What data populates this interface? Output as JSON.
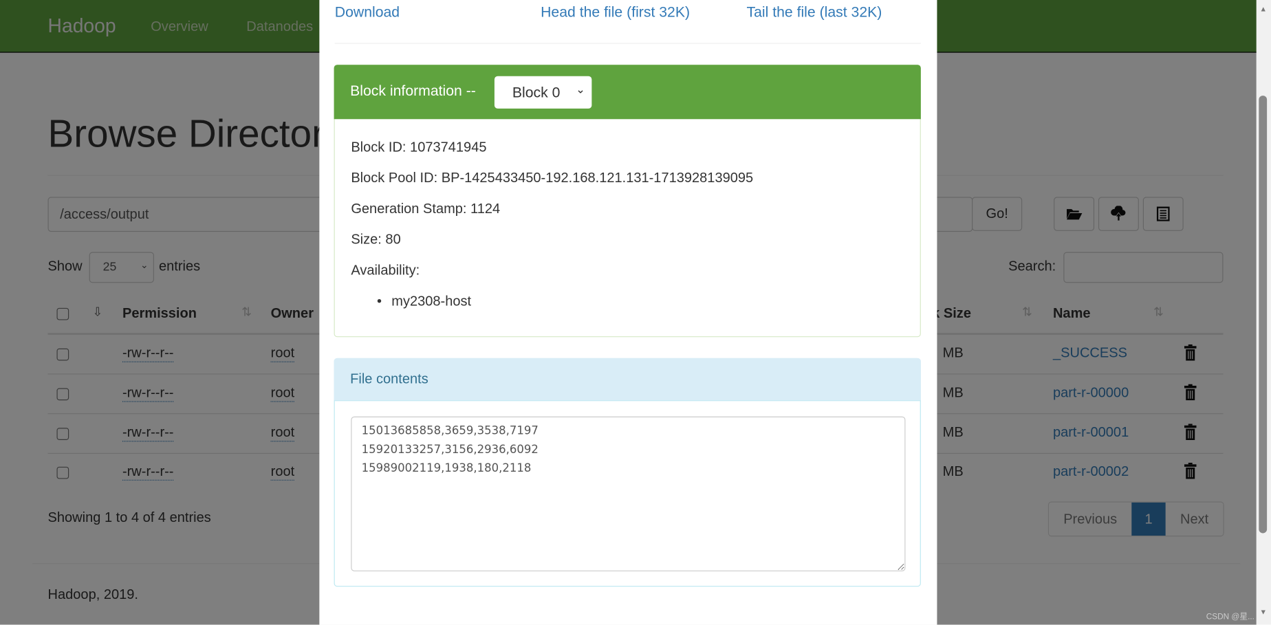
{
  "navbar": {
    "brand": "Hadoop",
    "items": [
      "Overview",
      "Datanodes"
    ]
  },
  "page": {
    "title": "Browse Directory",
    "path_value": "/access/output",
    "go_label": "Go!",
    "toolbar_icons": [
      "folder-open-icon",
      "cloud-upload-icon",
      "list-icon"
    ],
    "show_label": "Show",
    "entries_select": "25",
    "entries_label": "entries",
    "search_label": "Search:",
    "search_value": "",
    "columns": [
      "Permission",
      "Owner",
      "Block Size",
      "Name"
    ],
    "rows": [
      {
        "permission": "-rw-r--r--",
        "owner": "root",
        "block_size": "MB",
        "name": "_SUCCESS"
      },
      {
        "permission": "-rw-r--r--",
        "owner": "root",
        "block_size": "MB",
        "name": "part-r-00000"
      },
      {
        "permission": "-rw-r--r--",
        "owner": "root",
        "block_size": "MB",
        "name": "part-r-00001"
      },
      {
        "permission": "-rw-r--r--",
        "owner": "root",
        "block_size": "MB",
        "name": "part-r-00002"
      }
    ],
    "info": "Showing 1 to 4 of 4 entries",
    "pagination": {
      "previous": "Previous",
      "current": "1",
      "next": "Next"
    },
    "footer": "Hadoop, 2019."
  },
  "modal": {
    "links": {
      "download": "Download",
      "head": "Head the file (first 32K)",
      "tail": "Tail the file (last 32K)"
    },
    "block_panel": {
      "title": "Block information --",
      "block_select": "Block 0",
      "block_id": "Block ID: 1073741945",
      "pool_id": "Block Pool ID: BP-1425433450-192.168.121.131-1713928139095",
      "generation": "Generation Stamp: 1124",
      "size": "Size: 80",
      "availability": "Availability:",
      "hosts": [
        "my2308-host"
      ]
    },
    "file_panel": {
      "title": "File contents",
      "contents": "15013685858,3659,3538,7197\n15920133257,3156,2936,6092\n15989002119,1938,180,2118"
    }
  },
  "watermark": "CSDN @星...",
  "colors": {
    "navbar": "#5fa33e",
    "panel_header": "#5fa33e",
    "info_header": "#d9edf7",
    "link": "#337ab7",
    "active_page": "#337ab7"
  }
}
